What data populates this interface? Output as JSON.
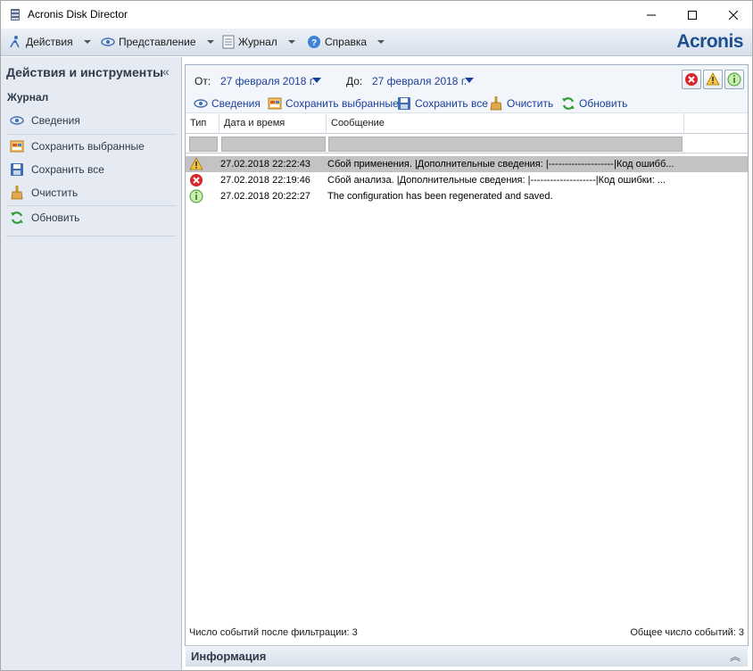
{
  "window": {
    "title": "Acronis Disk Director"
  },
  "menubar": {
    "items": [
      {
        "label": "Действия",
        "icon": "actions-icon"
      },
      {
        "label": "Представление",
        "icon": "eye-icon"
      },
      {
        "label": "Журнал",
        "icon": "log-icon"
      },
      {
        "label": "Справка",
        "icon": "help-icon"
      }
    ],
    "logo": "Acronis"
  },
  "left_panel": {
    "title": "Действия и инструменты",
    "section": "Журнал",
    "items": [
      {
        "label": "Сведения",
        "icon": "eye-icon"
      },
      {
        "label": "Сохранить выбранные",
        "icon": "save-selected-icon"
      },
      {
        "label": "Сохранить все",
        "icon": "save-icon"
      },
      {
        "label": "Очистить",
        "icon": "broom-icon"
      },
      {
        "label": "Обновить",
        "icon": "refresh-icon"
      }
    ]
  },
  "filter": {
    "from_label": "От:",
    "from_value": "27 февраля 2018 г.",
    "to_label": "До:",
    "to_value": "27 февраля 2018 г."
  },
  "toolbar": {
    "items": [
      {
        "label": "Сведения"
      },
      {
        "label": "Сохранить выбранные"
      },
      {
        "label": "Сохранить все"
      },
      {
        "label": "Очистить"
      },
      {
        "label": "Обновить"
      }
    ]
  },
  "table": {
    "columns": [
      "Тип",
      "Дата и время",
      "Сообщение"
    ],
    "rows": [
      {
        "type": "warning",
        "datetime": "27.02.2018 22:22:43",
        "message": "Сбой применения. |Дополнительные сведения: |--------------------|Код ошибб..."
      },
      {
        "type": "error",
        "datetime": "27.02.2018 22:19:46",
        "message": "Сбой анализа. |Дополнительные сведения: |--------------------|Код ошибки: ..."
      },
      {
        "type": "info",
        "datetime": "27.02.2018 20:22:27",
        "message": "The configuration has been regenerated and saved."
      }
    ]
  },
  "status": {
    "filtered": "Число событий после фильтрации: 3",
    "total": "Общее число событий: 3"
  },
  "info_panel": {
    "label": "Информация"
  }
}
